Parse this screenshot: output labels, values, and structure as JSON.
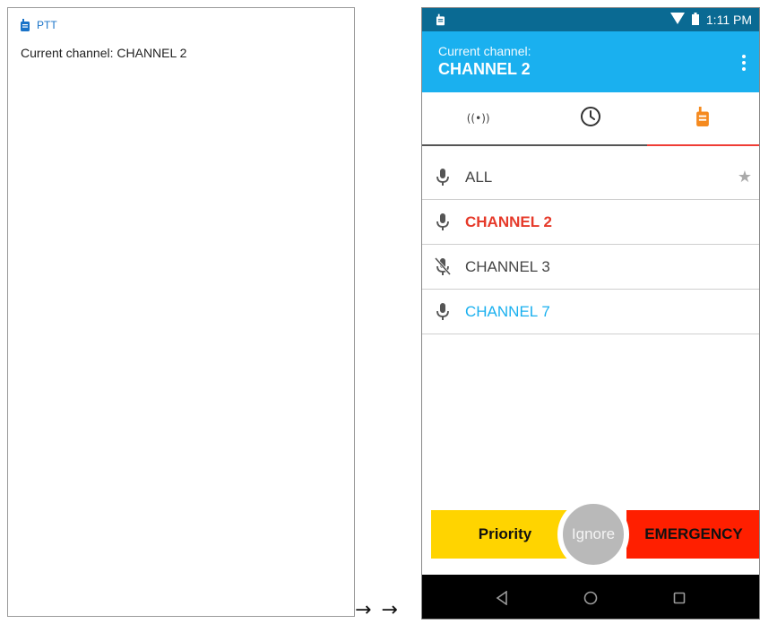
{
  "notification": {
    "app_name": "PTT",
    "text": "Current channel: CHANNEL 2",
    "icon": "walkie-talkie-icon"
  },
  "arrows": "→ →",
  "status_bar": {
    "time": "1:11 PM",
    "icons": [
      "walkie-talkie-icon",
      "wifi-icon",
      "battery-icon"
    ]
  },
  "app_bar": {
    "label": "Current channel:",
    "channel": "CHANNEL 2",
    "menu_icon": "more-vert-icon"
  },
  "tabs": [
    {
      "icon": "broadcast-icon",
      "glyph": "((•))"
    },
    {
      "icon": "clock-icon"
    },
    {
      "icon": "walkie-talkie-icon",
      "selected": true
    }
  ],
  "channels": [
    {
      "name": "ALL",
      "icon": "mic-icon",
      "color": "#444444",
      "bold": false,
      "star": "★"
    },
    {
      "name": "CHANNEL 2",
      "icon": "mic-icon",
      "color": "#e63a2a",
      "bold": true
    },
    {
      "name": "CHANNEL 3",
      "icon": "mic-off-icon",
      "color": "#444444",
      "bold": false
    },
    {
      "name": "CHANNEL 7",
      "icon": "mic-icon",
      "color": "#1ab0ef",
      "bold": false
    }
  ],
  "actions": {
    "priority": "Priority",
    "ignore": "Ignore",
    "emergency": "EMERGENCY"
  },
  "nav": [
    "back-icon",
    "home-icon",
    "recents-icon"
  ],
  "colors": {
    "status_bar": "#0a6a93",
    "app_bar": "#1ab0ef",
    "accent_tab": "#ef3d35",
    "priority": "#ffd400",
    "emergency": "#ff1f00",
    "ignore": "#b9b9b9"
  }
}
